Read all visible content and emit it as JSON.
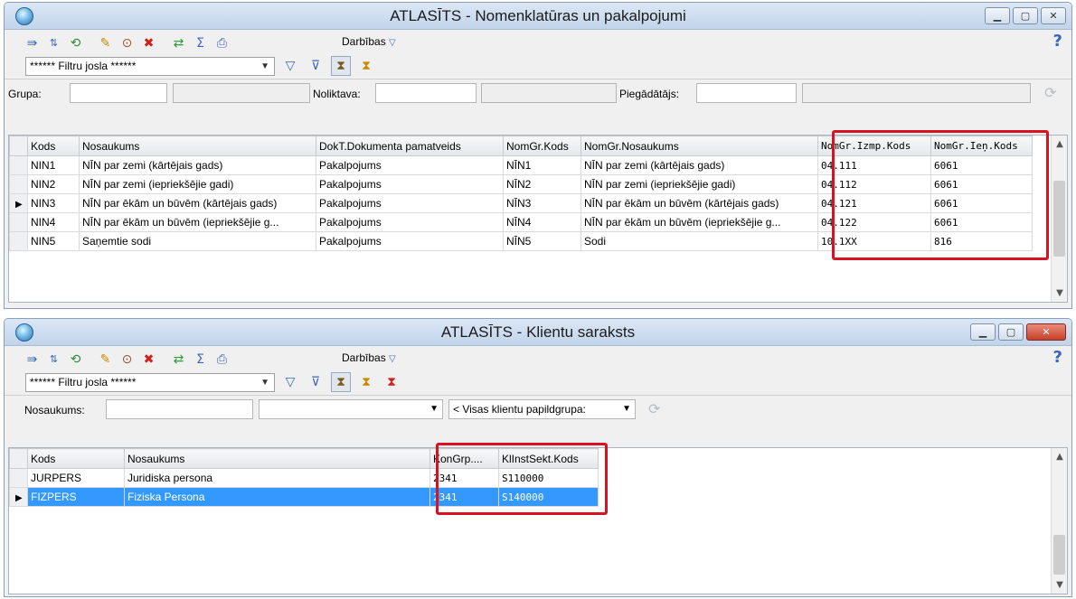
{
  "window1": {
    "title": "ATLASĪTS - Nomenklatūras un pakalpojumi",
    "actions_label": "Darbības",
    "filter_bar": "****** Filtru josla ******",
    "criteria": {
      "group_label": "Grupa:",
      "warehouse_label": "Noliktava:",
      "supplier_label": "Piegādātājs:"
    },
    "columns": [
      "Kods",
      "Nosaukums",
      "DokT.Dokumenta pamatveids",
      "NomGr.Kods",
      "NomGr.Nosaukums",
      "NomGr.Izmp.Kods",
      "NomGr.Ieņ.Kods"
    ],
    "rows": [
      [
        "NIN1",
        "NĪN par zemi (kārtējais gads)",
        "Pakalpojums",
        "NĪN1",
        "NĪN par zemi (kārtējais gads)",
        "04.111",
        "6061"
      ],
      [
        "NIN2",
        "NĪN par zemi (iepriekšējie gadi)",
        "Pakalpojums",
        "NĪN2",
        "NĪN par zemi (iepriekšējie gadi)",
        "04.112",
        "6061"
      ],
      [
        "NIN3",
        "NĪN par ēkām un būvēm (kārtējais gads)",
        "Pakalpojums",
        "NĪN3",
        "NĪN par ēkām un būvēm (kārtējais gads)",
        "04.121",
        "6061"
      ],
      [
        "NIN4",
        "NĪN par ēkām un būvēm (iepriekšējie g...",
        "Pakalpojums",
        "NĪN4",
        "NĪN par ēkām un būvēm (iepriekšējie g...",
        "04.122",
        "6061"
      ],
      [
        "NIN5",
        "Saņemtie sodi",
        "Pakalpojums",
        "NĪN5",
        "Sodi",
        "10.1XX",
        "816"
      ]
    ],
    "current_row": 2
  },
  "window2": {
    "title": "ATLASĪTS - Klientu saraksts",
    "actions_label": "Darbības",
    "filter_bar": "****** Filtru josla ******",
    "criteria": {
      "name_label": "Nosaukums:",
      "subgroup_select": "< Visas klientu papildgrupa:"
    },
    "columns": [
      "Kods",
      "Nosaukums",
      "KonGrp....",
      "KlInstSekt.Kods"
    ],
    "rows": [
      [
        "JURPERS",
        "Juridiska persona",
        "2341",
        "S110000"
      ],
      [
        "FIZPERS",
        "Fiziska Persona",
        "2341",
        "S140000"
      ]
    ],
    "selected_row": 1
  },
  "colors": {
    "highlight_box": "#d9121f",
    "selection": "#3399ff",
    "accent": "#3a66b8"
  },
  "icons": [
    "globe-icon",
    "export-icon",
    "sort-icon",
    "refresh-icon",
    "edit-icon",
    "view-icon",
    "delete-icon",
    "sync-icon",
    "sum-icon",
    "print-icon",
    "filter-icon",
    "filter-clear-icon",
    "hourglass-icon",
    "help-icon"
  ]
}
